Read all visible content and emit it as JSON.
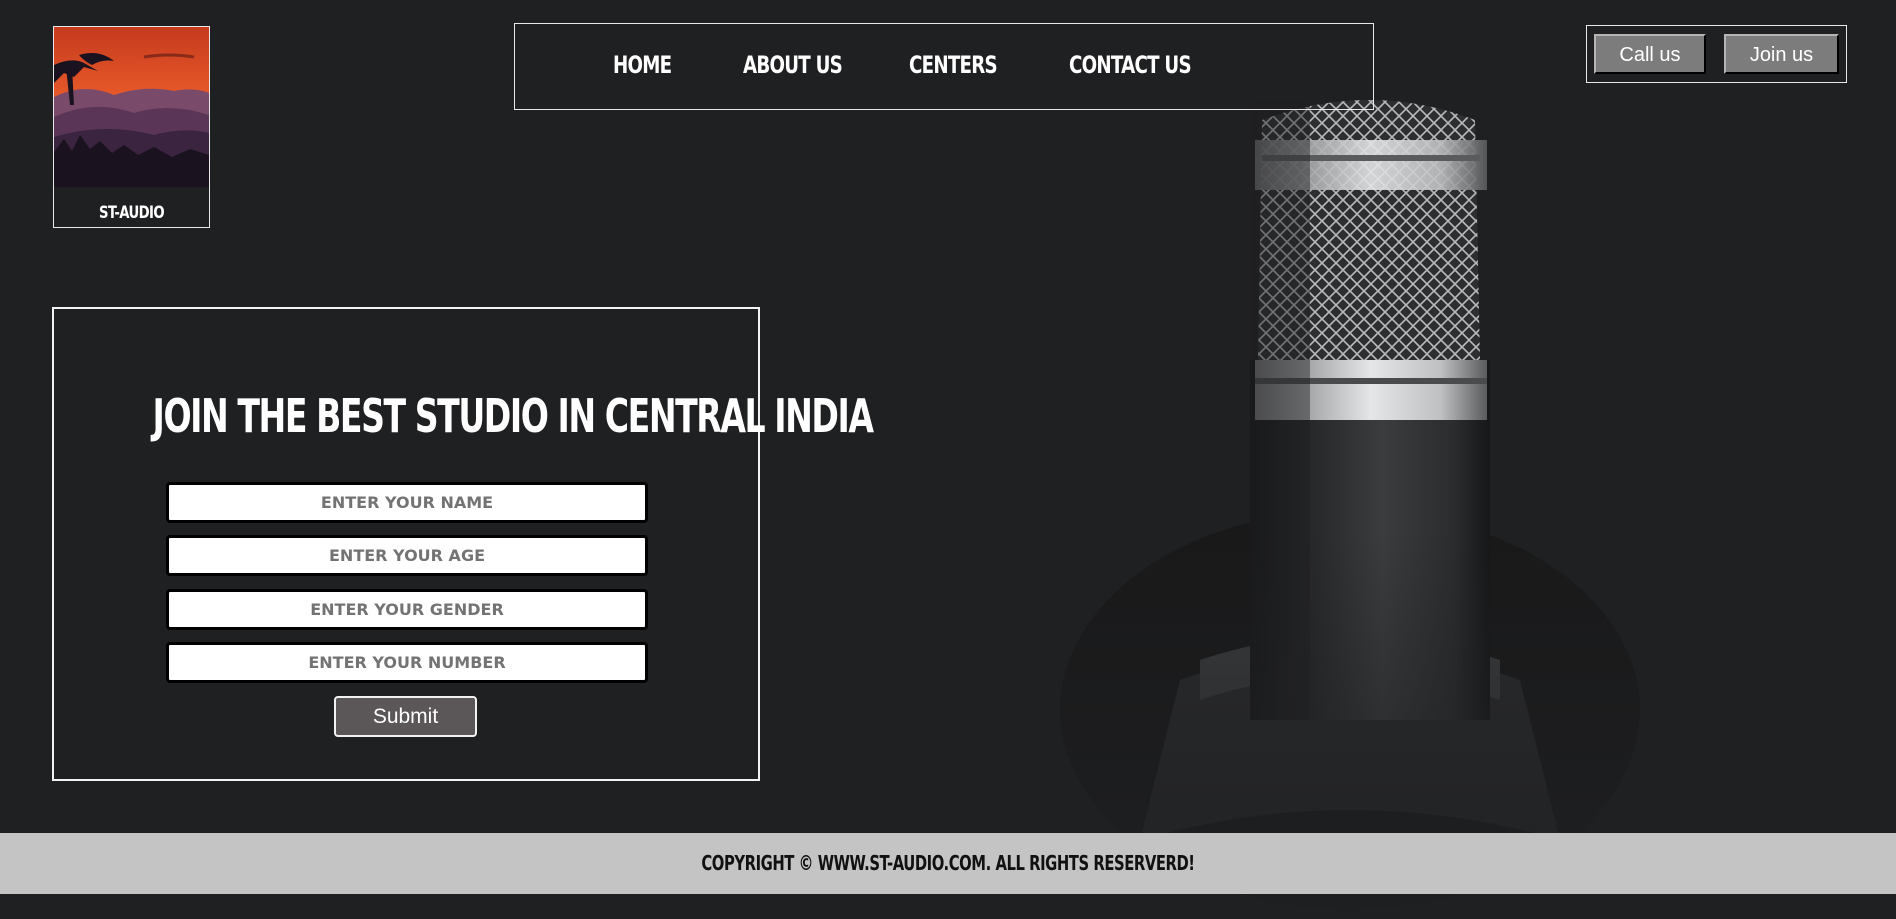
{
  "brand": {
    "name": "ST-AUDIO"
  },
  "nav": {
    "items": [
      {
        "label": "HOME"
      },
      {
        "label": "ABOUT US"
      },
      {
        "label": "CENTERS"
      },
      {
        "label": "CONTACT US"
      }
    ]
  },
  "header_buttons": {
    "call_label": "Call us",
    "join_label": "Join us"
  },
  "form": {
    "title": "JOIN THE BEST STUDIO IN CENTRAL INDIA",
    "name_placeholder": "ENTER YOUR NAME",
    "age_placeholder": "ENTER YOUR AGE",
    "gender_placeholder": "ENTER YOUR GENDER",
    "number_placeholder": "ENTER YOUR NUMBER",
    "submit_label": "Submit"
  },
  "footer": {
    "copyright": "COPYRIGHT © WWW.ST-AUDIO.COM. ALL RIGHTS RESERVERD!"
  },
  "colors": {
    "background": "#1f2022",
    "footer_bg": "#c4c4c4",
    "header_button": "#7c7c7c",
    "submit_button": "#5b5658",
    "border": "#e8e8e8"
  },
  "icons": {
    "logo": "sunset-mountains-logo",
    "background": "microphone-illustration"
  }
}
